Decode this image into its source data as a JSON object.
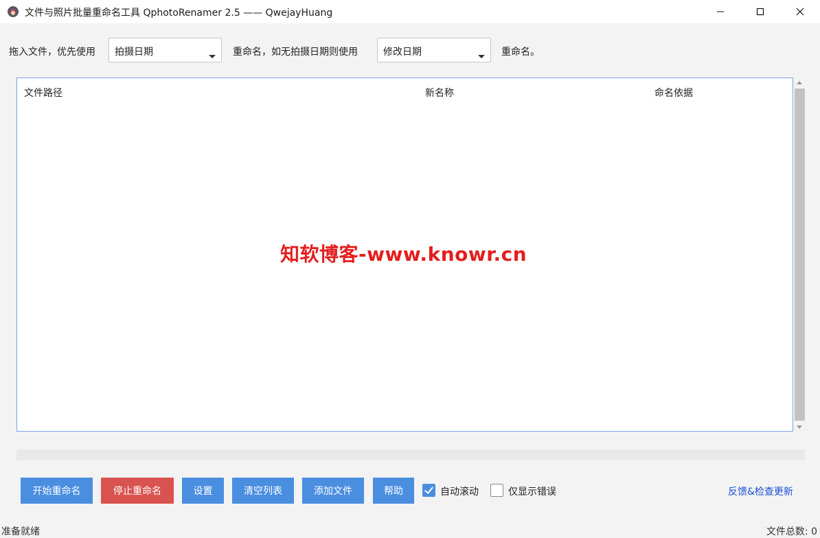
{
  "window": {
    "title": "文件与照片批量重命名工具 QphotoRenamer 2.5 —— QwejayHuang"
  },
  "options": {
    "prefix_text": "拖入文件，优先使用",
    "primary_select": "拍摄日期",
    "middle_text": "重命名，如无拍摄日期则使用",
    "fallback_select": "修改日期",
    "suffix_text": "重命名。"
  },
  "table": {
    "columns": [
      "文件路径",
      "新名称",
      "命名依据"
    ],
    "rows": []
  },
  "watermark": "知软博客-www.knowr.cn",
  "buttons": {
    "start": "开始重命名",
    "stop": "停止重命名",
    "settings": "设置",
    "clear": "清空列表",
    "add": "添加文件",
    "help": "帮助"
  },
  "checkboxes": {
    "auto_scroll": {
      "label": "自动滚动",
      "checked": true
    },
    "errors_only": {
      "label": "仅显示错误",
      "checked": false
    }
  },
  "feedback_link": "反馈&检查更新",
  "status": {
    "state": "准备就绪",
    "file_count": "文件总数: 0"
  },
  "colors": {
    "accent": "#4a8ee0",
    "danger": "#d9534f",
    "watermark": "#e41e1e",
    "link": "#1a4fd6"
  }
}
